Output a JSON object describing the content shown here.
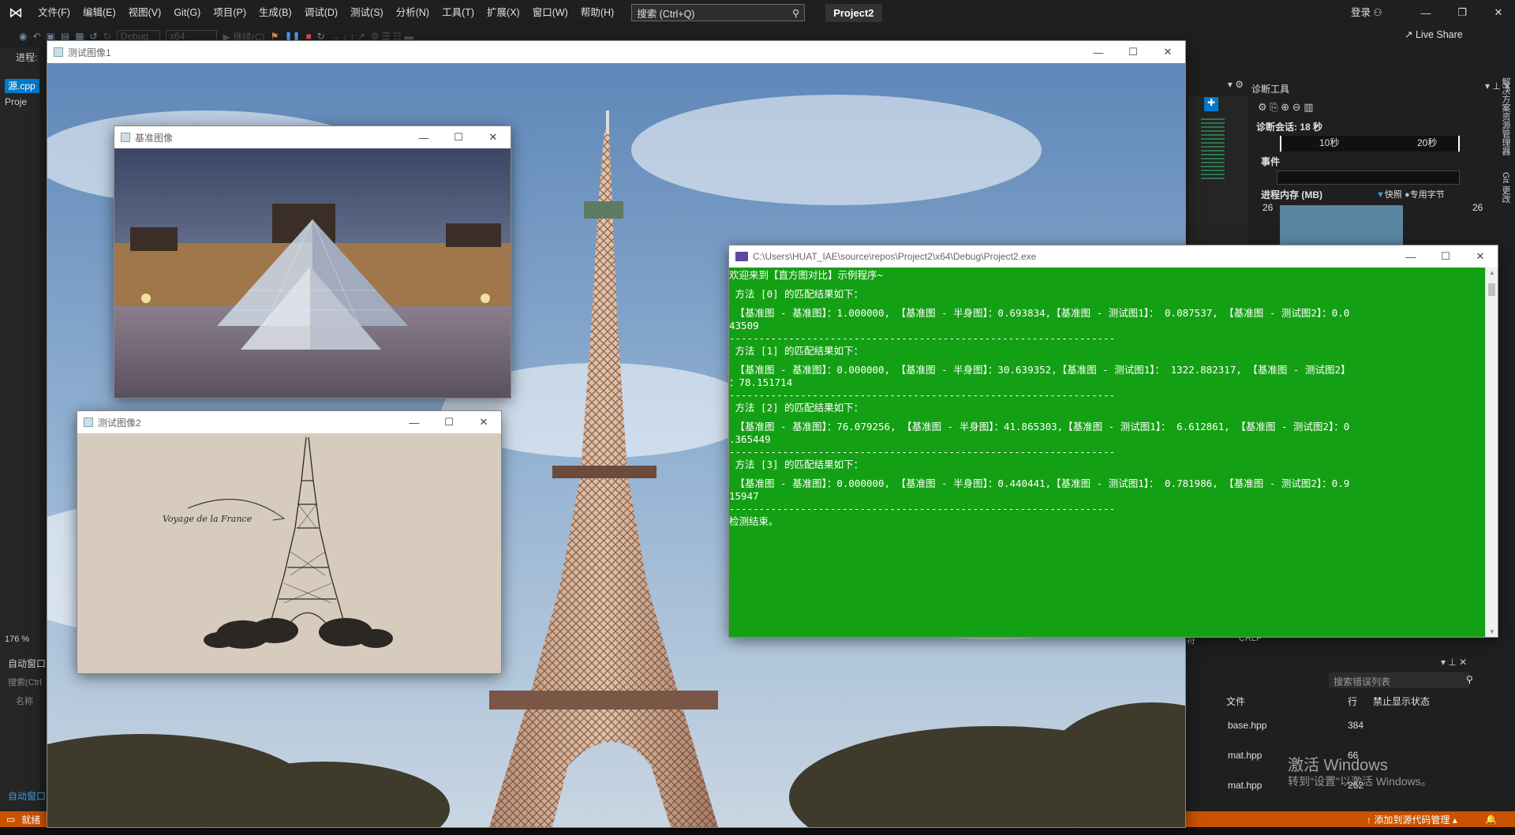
{
  "vs": {
    "menu": [
      "文件(F)",
      "编辑(E)",
      "视图(V)",
      "Git(G)",
      "项目(P)",
      "生成(B)",
      "调试(D)",
      "测试(S)",
      "分析(N)",
      "工具(T)",
      "扩展(X)",
      "窗口(W)",
      "帮助(H)"
    ],
    "search_placeholder": "搜索 (Ctrl+Q)",
    "project_title": "Project2",
    "login": "登录",
    "toolbar": {
      "config": "Debug",
      "platform": "x64",
      "continue": "继续(C)",
      "live_share": "Live Share"
    },
    "left": {
      "process_label": "进程:",
      "tab_source": "源.cpp",
      "tab_project": "Proje",
      "zoom": "176 %",
      "auto_window": "自动窗口",
      "auto_search": "搜索(Ctrl",
      "auto_name": "名称",
      "auto_window_bottom": "自动窗口"
    },
    "status": {
      "ready": "就绪",
      "add_source": "添加到源代码管理"
    },
    "diag": {
      "title": "诊断工具",
      "session": "诊断会话: 18 秒",
      "tick1": "10秒",
      "tick2": "20秒",
      "events": "事件",
      "memory": "进程内存 (MB)",
      "snapshot": "快照",
      "private_bytes": "专用字节",
      "mem_left": "26",
      "mem_right": "26"
    },
    "side_labels": [
      "解决方案资源管理器",
      "Git 更改"
    ],
    "line_end": {
      "encoding": "符",
      "crlf": "CRLF"
    },
    "errors": {
      "search": "搜索错误列表",
      "col_file": "文件",
      "col_line": "行",
      "col_suppress": "禁止显示状态",
      "rows": [
        {
          "file": "base.hpp",
          "line": "384"
        },
        {
          "file": "mat.hpp",
          "line": "66"
        },
        {
          "file": "mat.hpp",
          "line": "262"
        }
      ]
    },
    "watermark": {
      "line1": "激活 Windows",
      "line2": "转到\"设置\"以激活 Windows。"
    }
  },
  "windows": {
    "test1": {
      "title": "测试图像1"
    },
    "base": {
      "title": "基准图像"
    },
    "test2": {
      "title": "测试图像2",
      "art_text": "Voyage de la France"
    },
    "console": {
      "title": "C:\\Users\\HUAT_IAE\\source\\repos\\Project2\\x64\\Debug\\Project2.exe",
      "lines": [
        "欢迎来到【直方图对比】示例程序~",
        "",
        " 方法 [0] 的匹配结果如下：",
        "",
        " 【基准图 - 基准图】：1.000000, 【基准图 - 半身图】：0.693834,【基准图 - 测试图1】： 0.087537, 【基准图 - 测试图2】：0.0",
        "43509",
        "-----------------------------------------------------------------",
        " 方法 [1] 的匹配结果如下：",
        "",
        " 【基准图 - 基准图】：0.000000, 【基准图 - 半身图】：30.639352,【基准图 - 测试图1】： 1322.882317, 【基准图 - 测试图2】",
        "：78.151714",
        "-----------------------------------------------------------------",
        " 方法 [2] 的匹配结果如下：",
        "",
        " 【基准图 - 基准图】：76.079256, 【基准图 - 半身图】：41.865303,【基准图 - 测试图1】： 6.612861, 【基准图 - 测试图2】：0",
        ".365449",
        "-----------------------------------------------------------------",
        " 方法 [3] 的匹配结果如下：",
        "",
        " 【基准图 - 基准图】：0.000000, 【基准图 - 半身图】：0.440441,【基准图 - 测试图1】： 0.781986, 【基准图 - 测试图2】：0.9",
        "15947",
        "-----------------------------------------------------------------",
        "检测结束。"
      ]
    }
  }
}
